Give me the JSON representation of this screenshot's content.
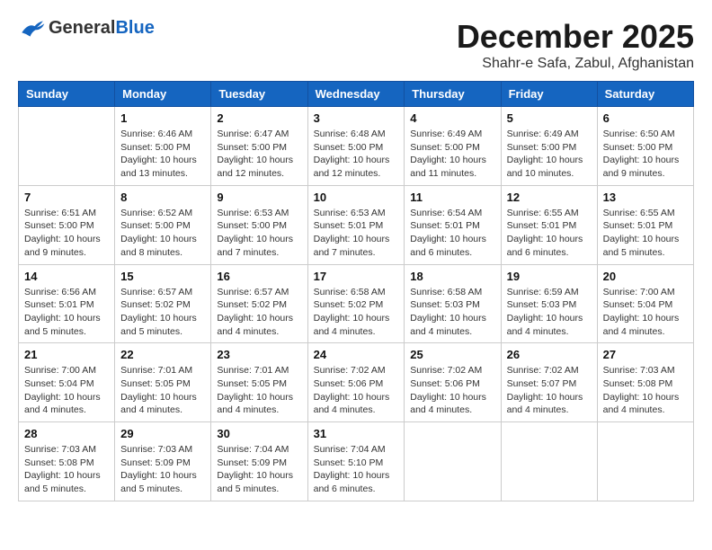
{
  "header": {
    "logo_general": "General",
    "logo_blue": "Blue",
    "month_title": "December 2025",
    "location": "Shahr-e Safa, Zabul, Afghanistan"
  },
  "days_of_week": [
    "Sunday",
    "Monday",
    "Tuesday",
    "Wednesday",
    "Thursday",
    "Friday",
    "Saturday"
  ],
  "weeks": [
    [
      {
        "day": "",
        "info": ""
      },
      {
        "day": "1",
        "info": "Sunrise: 6:46 AM\nSunset: 5:00 PM\nDaylight: 10 hours\nand 13 minutes."
      },
      {
        "day": "2",
        "info": "Sunrise: 6:47 AM\nSunset: 5:00 PM\nDaylight: 10 hours\nand 12 minutes."
      },
      {
        "day": "3",
        "info": "Sunrise: 6:48 AM\nSunset: 5:00 PM\nDaylight: 10 hours\nand 12 minutes."
      },
      {
        "day": "4",
        "info": "Sunrise: 6:49 AM\nSunset: 5:00 PM\nDaylight: 10 hours\nand 11 minutes."
      },
      {
        "day": "5",
        "info": "Sunrise: 6:49 AM\nSunset: 5:00 PM\nDaylight: 10 hours\nand 10 minutes."
      },
      {
        "day": "6",
        "info": "Sunrise: 6:50 AM\nSunset: 5:00 PM\nDaylight: 10 hours\nand 9 minutes."
      }
    ],
    [
      {
        "day": "7",
        "info": "Sunrise: 6:51 AM\nSunset: 5:00 PM\nDaylight: 10 hours\nand 9 minutes."
      },
      {
        "day": "8",
        "info": "Sunrise: 6:52 AM\nSunset: 5:00 PM\nDaylight: 10 hours\nand 8 minutes."
      },
      {
        "day": "9",
        "info": "Sunrise: 6:53 AM\nSunset: 5:00 PM\nDaylight: 10 hours\nand 7 minutes."
      },
      {
        "day": "10",
        "info": "Sunrise: 6:53 AM\nSunset: 5:01 PM\nDaylight: 10 hours\nand 7 minutes."
      },
      {
        "day": "11",
        "info": "Sunrise: 6:54 AM\nSunset: 5:01 PM\nDaylight: 10 hours\nand 6 minutes."
      },
      {
        "day": "12",
        "info": "Sunrise: 6:55 AM\nSunset: 5:01 PM\nDaylight: 10 hours\nand 6 minutes."
      },
      {
        "day": "13",
        "info": "Sunrise: 6:55 AM\nSunset: 5:01 PM\nDaylight: 10 hours\nand 5 minutes."
      }
    ],
    [
      {
        "day": "14",
        "info": "Sunrise: 6:56 AM\nSunset: 5:01 PM\nDaylight: 10 hours\nand 5 minutes."
      },
      {
        "day": "15",
        "info": "Sunrise: 6:57 AM\nSunset: 5:02 PM\nDaylight: 10 hours\nand 5 minutes."
      },
      {
        "day": "16",
        "info": "Sunrise: 6:57 AM\nSunset: 5:02 PM\nDaylight: 10 hours\nand 4 minutes."
      },
      {
        "day": "17",
        "info": "Sunrise: 6:58 AM\nSunset: 5:02 PM\nDaylight: 10 hours\nand 4 minutes."
      },
      {
        "day": "18",
        "info": "Sunrise: 6:58 AM\nSunset: 5:03 PM\nDaylight: 10 hours\nand 4 minutes."
      },
      {
        "day": "19",
        "info": "Sunrise: 6:59 AM\nSunset: 5:03 PM\nDaylight: 10 hours\nand 4 minutes."
      },
      {
        "day": "20",
        "info": "Sunrise: 7:00 AM\nSunset: 5:04 PM\nDaylight: 10 hours\nand 4 minutes."
      }
    ],
    [
      {
        "day": "21",
        "info": "Sunrise: 7:00 AM\nSunset: 5:04 PM\nDaylight: 10 hours\nand 4 minutes."
      },
      {
        "day": "22",
        "info": "Sunrise: 7:01 AM\nSunset: 5:05 PM\nDaylight: 10 hours\nand 4 minutes."
      },
      {
        "day": "23",
        "info": "Sunrise: 7:01 AM\nSunset: 5:05 PM\nDaylight: 10 hours\nand 4 minutes."
      },
      {
        "day": "24",
        "info": "Sunrise: 7:02 AM\nSunset: 5:06 PM\nDaylight: 10 hours\nand 4 minutes."
      },
      {
        "day": "25",
        "info": "Sunrise: 7:02 AM\nSunset: 5:06 PM\nDaylight: 10 hours\nand 4 minutes."
      },
      {
        "day": "26",
        "info": "Sunrise: 7:02 AM\nSunset: 5:07 PM\nDaylight: 10 hours\nand 4 minutes."
      },
      {
        "day": "27",
        "info": "Sunrise: 7:03 AM\nSunset: 5:08 PM\nDaylight: 10 hours\nand 4 minutes."
      }
    ],
    [
      {
        "day": "28",
        "info": "Sunrise: 7:03 AM\nSunset: 5:08 PM\nDaylight: 10 hours\nand 5 minutes."
      },
      {
        "day": "29",
        "info": "Sunrise: 7:03 AM\nSunset: 5:09 PM\nDaylight: 10 hours\nand 5 minutes."
      },
      {
        "day": "30",
        "info": "Sunrise: 7:04 AM\nSunset: 5:09 PM\nDaylight: 10 hours\nand 5 minutes."
      },
      {
        "day": "31",
        "info": "Sunrise: 7:04 AM\nSunset: 5:10 PM\nDaylight: 10 hours\nand 6 minutes."
      },
      {
        "day": "",
        "info": ""
      },
      {
        "day": "",
        "info": ""
      },
      {
        "day": "",
        "info": ""
      }
    ]
  ]
}
